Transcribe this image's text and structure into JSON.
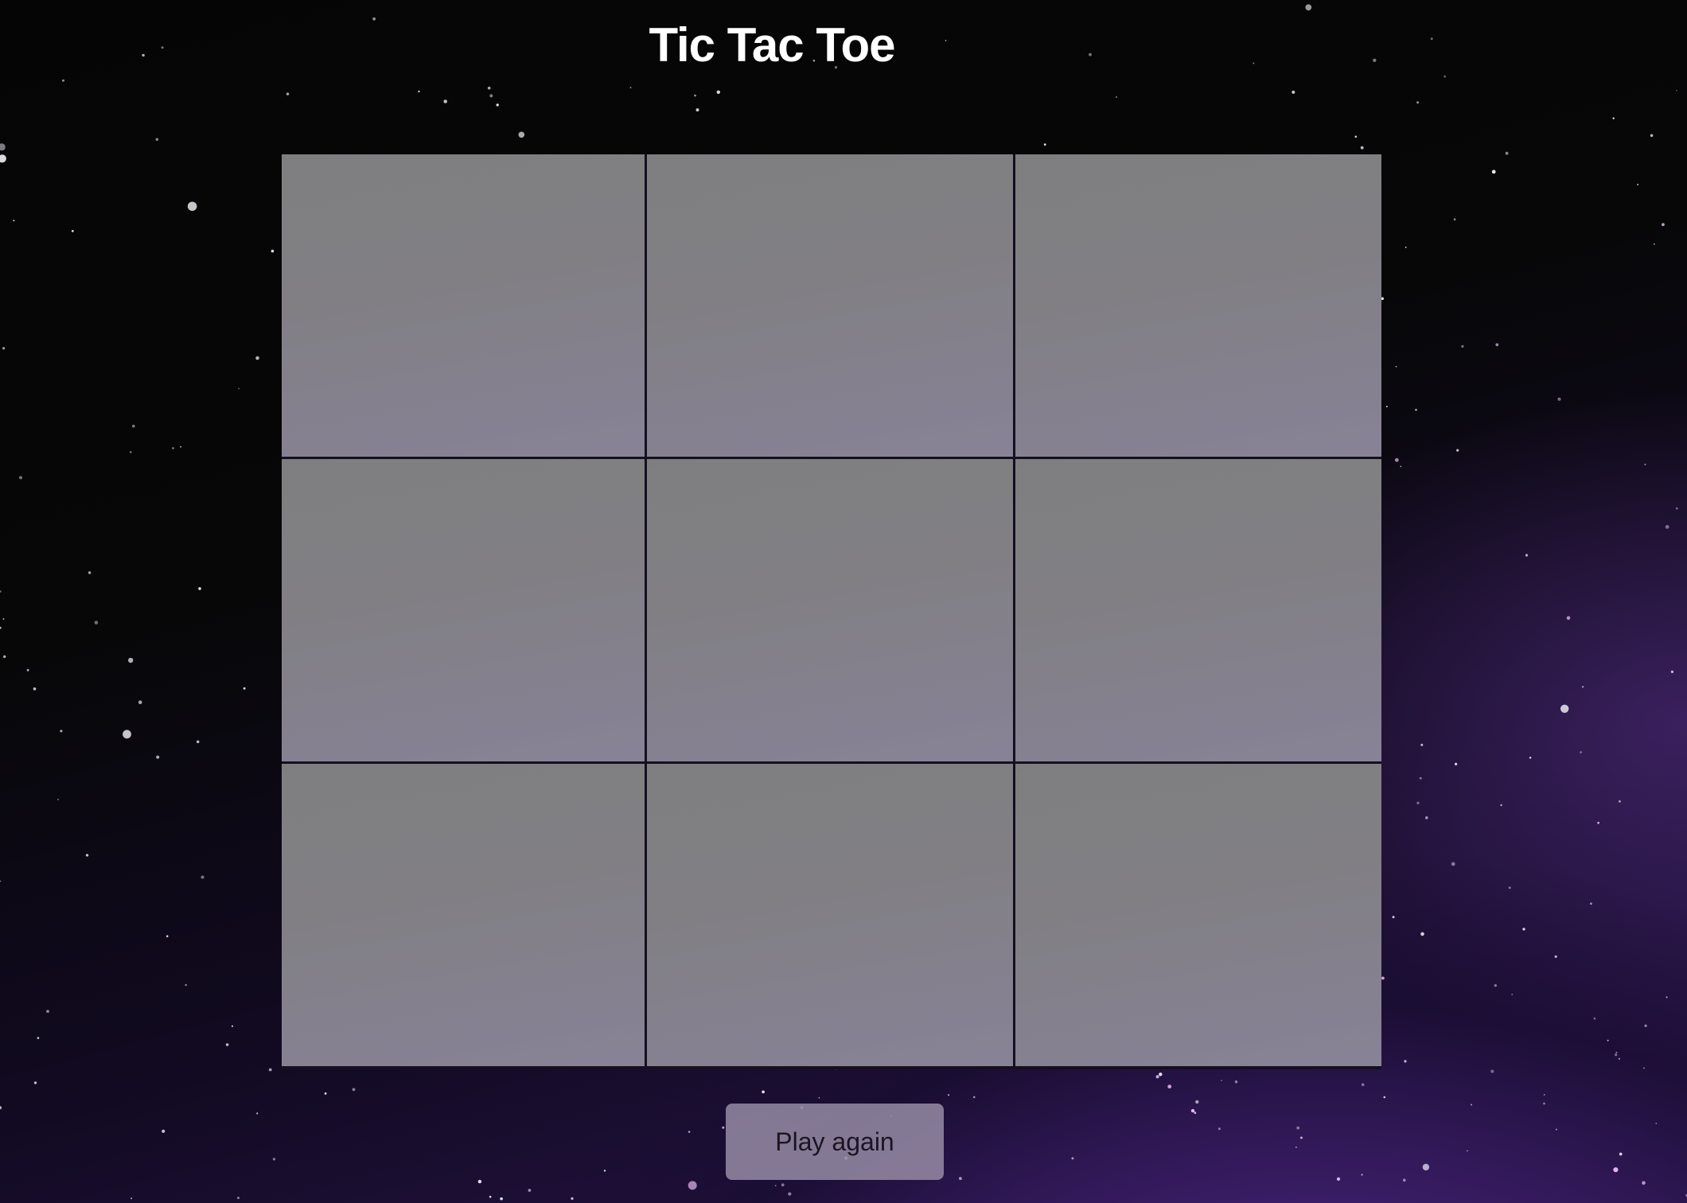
{
  "page": {
    "title": "Tic Tac Toe"
  },
  "board": {
    "cells": [
      {
        "id": 1,
        "mark": ""
      },
      {
        "id": 2,
        "mark": ""
      },
      {
        "id": 3,
        "mark": ""
      },
      {
        "id": 4,
        "mark": ""
      },
      {
        "id": 5,
        "mark": ""
      },
      {
        "id": 6,
        "mark": ""
      },
      {
        "id": 7,
        "mark": ""
      },
      {
        "id": 8,
        "mark": ""
      },
      {
        "id": 9,
        "mark": ""
      }
    ]
  },
  "controls": {
    "play_again_label": "Play again"
  },
  "colors": {
    "background": "#070708",
    "galaxy_purple": "#5a2d8c",
    "cell_fill": "#868586",
    "grid_line": "#141020",
    "title_text": "#ffffff"
  }
}
